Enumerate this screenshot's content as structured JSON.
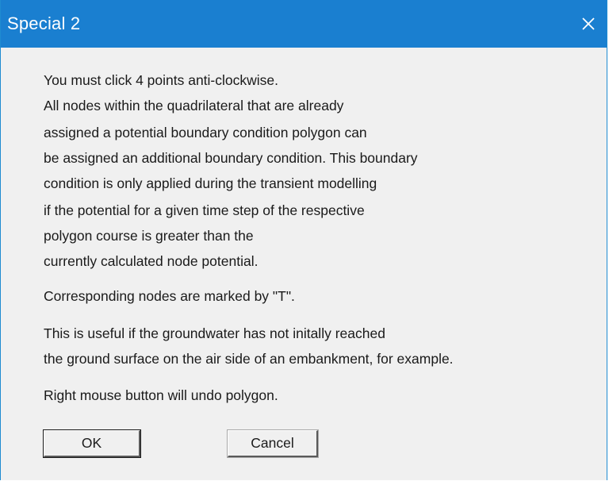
{
  "window": {
    "title": "Special 2",
    "close_icon": "close-icon"
  },
  "message": {
    "lines": [
      "You must click 4 points anti-clockwise.",
      "All nodes within the quadrilateral that are already",
      "assigned a potential boundary condition polygon can",
      "be assigned an additional boundary condition. This boundary",
      "condition is only applied during the transient modelling",
      "if the potential for a given time step of the respective",
      "polygon course is greater than the",
      "currently calculated node potential."
    ],
    "marked_note": "Corresponding nodes are marked by \"T\".",
    "useful_lines": [
      "This is useful if the groundwater has not initally reached",
      "the ground surface on the air side of an embankment, for example."
    ],
    "undo_note": "Right mouse button will undo polygon."
  },
  "buttons": {
    "ok_label": "OK",
    "cancel_label": "Cancel"
  },
  "colors": {
    "titlebar": "#1a7fd0",
    "dialog_background": "#f0f0f0",
    "text": "#1a1a1a"
  }
}
